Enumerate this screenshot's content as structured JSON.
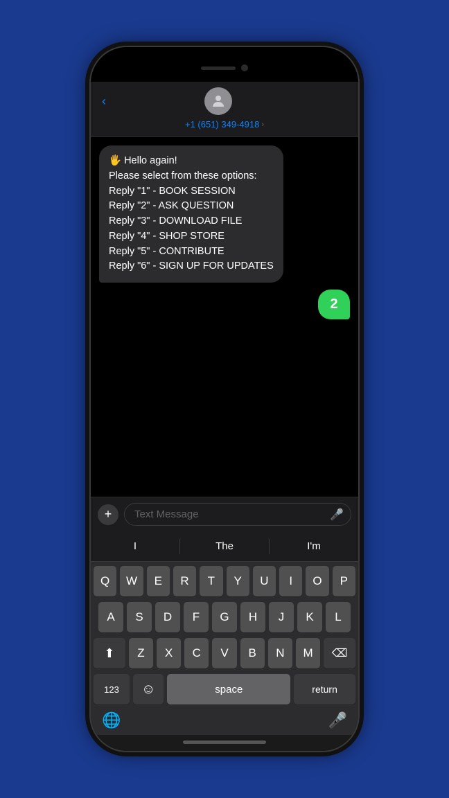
{
  "phone": {
    "header": {
      "back_label": "‹",
      "contact_number": "+1 (651) 349-4918",
      "chevron": "›"
    },
    "messages": [
      {
        "type": "incoming",
        "text": "🖐 Hello again!\nPlease select from these options:\nReply \"1\" - BOOK SESSION\nReply \"2\" - ASK QUESTION\nReply \"3\" - DOWNLOAD FILE\nReply \"4\" - SHOP STORE\nReply \"5\" - CONTRIBUTE\nReply \"6\" - SIGN UP FOR UPDATES"
      },
      {
        "type": "outgoing",
        "text": "2"
      }
    ],
    "input": {
      "placeholder": "Text Message",
      "add_icon": "+",
      "mic_icon": "🎤"
    },
    "keyboard": {
      "suggestions": [
        "I",
        "The",
        "I'm"
      ],
      "rows": [
        [
          "Q",
          "W",
          "E",
          "R",
          "T",
          "Y",
          "U",
          "I",
          "O",
          "P"
        ],
        [
          "A",
          "S",
          "D",
          "F",
          "G",
          "H",
          "J",
          "K",
          "L"
        ],
        [
          "⬆",
          "Z",
          "X",
          "C",
          "V",
          "B",
          "N",
          "M",
          "⌫"
        ],
        [
          "123",
          "☺",
          "space",
          "return"
        ]
      ]
    }
  }
}
